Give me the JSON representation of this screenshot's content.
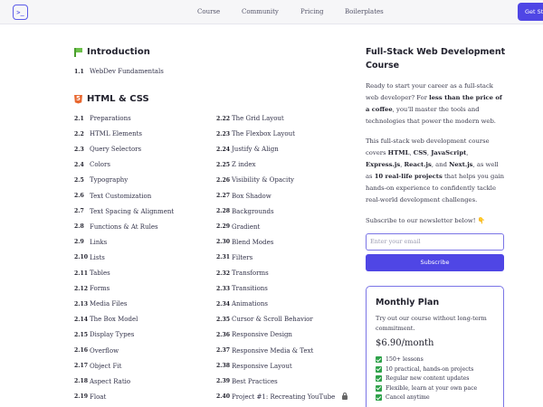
{
  "header": {
    "logo_text": ">_",
    "nav": [
      "Course",
      "Community",
      "Pricing",
      "Boilerplates"
    ],
    "cta_label": "Get St"
  },
  "intro": {
    "title": "Introduction",
    "lessons": [
      {
        "num": "1.1",
        "title": "WebDev Fundamentals"
      }
    ]
  },
  "html_css": {
    "title": "HTML & CSS",
    "left_lessons": [
      {
        "num": "2.1",
        "title": "Preparations"
      },
      {
        "num": "2.2",
        "title": "HTML Elements"
      },
      {
        "num": "2.3",
        "title": "Query Selectors"
      },
      {
        "num": "2.4",
        "title": "Colors"
      },
      {
        "num": "2.5",
        "title": "Typography"
      },
      {
        "num": "2.6",
        "title": "Text Customization"
      },
      {
        "num": "2.7",
        "title": "Text Spacing & Alignment"
      },
      {
        "num": "2.8",
        "title": "Functions & At Rules"
      },
      {
        "num": "2.9",
        "title": "Links"
      },
      {
        "num": "2.10",
        "title": "Lists"
      },
      {
        "num": "2.11",
        "title": "Tables"
      },
      {
        "num": "2.12",
        "title": "Forms"
      },
      {
        "num": "2.13",
        "title": "Media Files"
      },
      {
        "num": "2.14",
        "title": "The Box Model"
      },
      {
        "num": "2.15",
        "title": "Display Types"
      },
      {
        "num": "2.16",
        "title": "Overflow"
      },
      {
        "num": "2.17",
        "title": "Object Fit"
      },
      {
        "num": "2.18",
        "title": "Aspect Ratio"
      },
      {
        "num": "2.19",
        "title": "Float"
      }
    ],
    "right_lessons": [
      {
        "num": "2.22",
        "title": "The Grid Layout"
      },
      {
        "num": "2.23",
        "title": "The Flexbox Layout"
      },
      {
        "num": "2.24",
        "title": "Justify & Align"
      },
      {
        "num": "2.25",
        "title": "Z index"
      },
      {
        "num": "2.26",
        "title": "Visibility & Opacity"
      },
      {
        "num": "2.27",
        "title": "Box Shadow"
      },
      {
        "num": "2.28",
        "title": "Backgrounds"
      },
      {
        "num": "2.29",
        "title": "Gradient"
      },
      {
        "num": "2.30",
        "title": "Blend Modes"
      },
      {
        "num": "2.31",
        "title": "Filters"
      },
      {
        "num": "2.32",
        "title": "Transforms"
      },
      {
        "num": "2.33",
        "title": "Transitions"
      },
      {
        "num": "2.34",
        "title": "Animations"
      },
      {
        "num": "2.35",
        "title": "Cursor & Scroll Behavior"
      },
      {
        "num": "2.36",
        "title": "Responsive Design"
      },
      {
        "num": "2.37",
        "title": "Responsive Media & Text"
      },
      {
        "num": "2.38",
        "title": "Responsive Layout"
      },
      {
        "num": "2.39",
        "title": "Best Practices"
      },
      {
        "num": "2.40",
        "title": "Project #1: Recreating YouTube",
        "locked": true
      }
    ]
  },
  "sidebar": {
    "title": "Full-Stack Web Development Course",
    "p1": {
      "a": "Ready to start your career as a full-stack web developer? For ",
      "b": "less than the price of a coffee",
      "c": ", you'll master the tools and technologies that power the modern web."
    },
    "p2": {
      "a": "This full-stack web development course covers ",
      "html": "HTML",
      "s1": ", ",
      "css": "CSS",
      "s2": ", ",
      "js": "JavaScript",
      "s3": ", ",
      "express": "Express.js",
      "s4": ", ",
      "react": "React.js",
      "s5": ", and ",
      "next": "Next.js",
      "s6": ", as well as ",
      "projects": "10 real-life projects",
      "tail": " that helps you gain hands-on experience to confidently tackle real-world development challenges."
    },
    "subscribe_text": "Subscribe to our newsletter below! 👇",
    "email_placeholder": "Enter your email",
    "subscribe_label": "Subscribe"
  },
  "plan": {
    "title": "Monthly Plan",
    "desc": "Try out our course without long-term commitment.",
    "price": "$6.90/month",
    "features": [
      "150+ lessons",
      "10 practical, hands-on projects",
      "Regular new content updates",
      "Flexible, learn at your own pace",
      "Cancel anytime"
    ]
  }
}
